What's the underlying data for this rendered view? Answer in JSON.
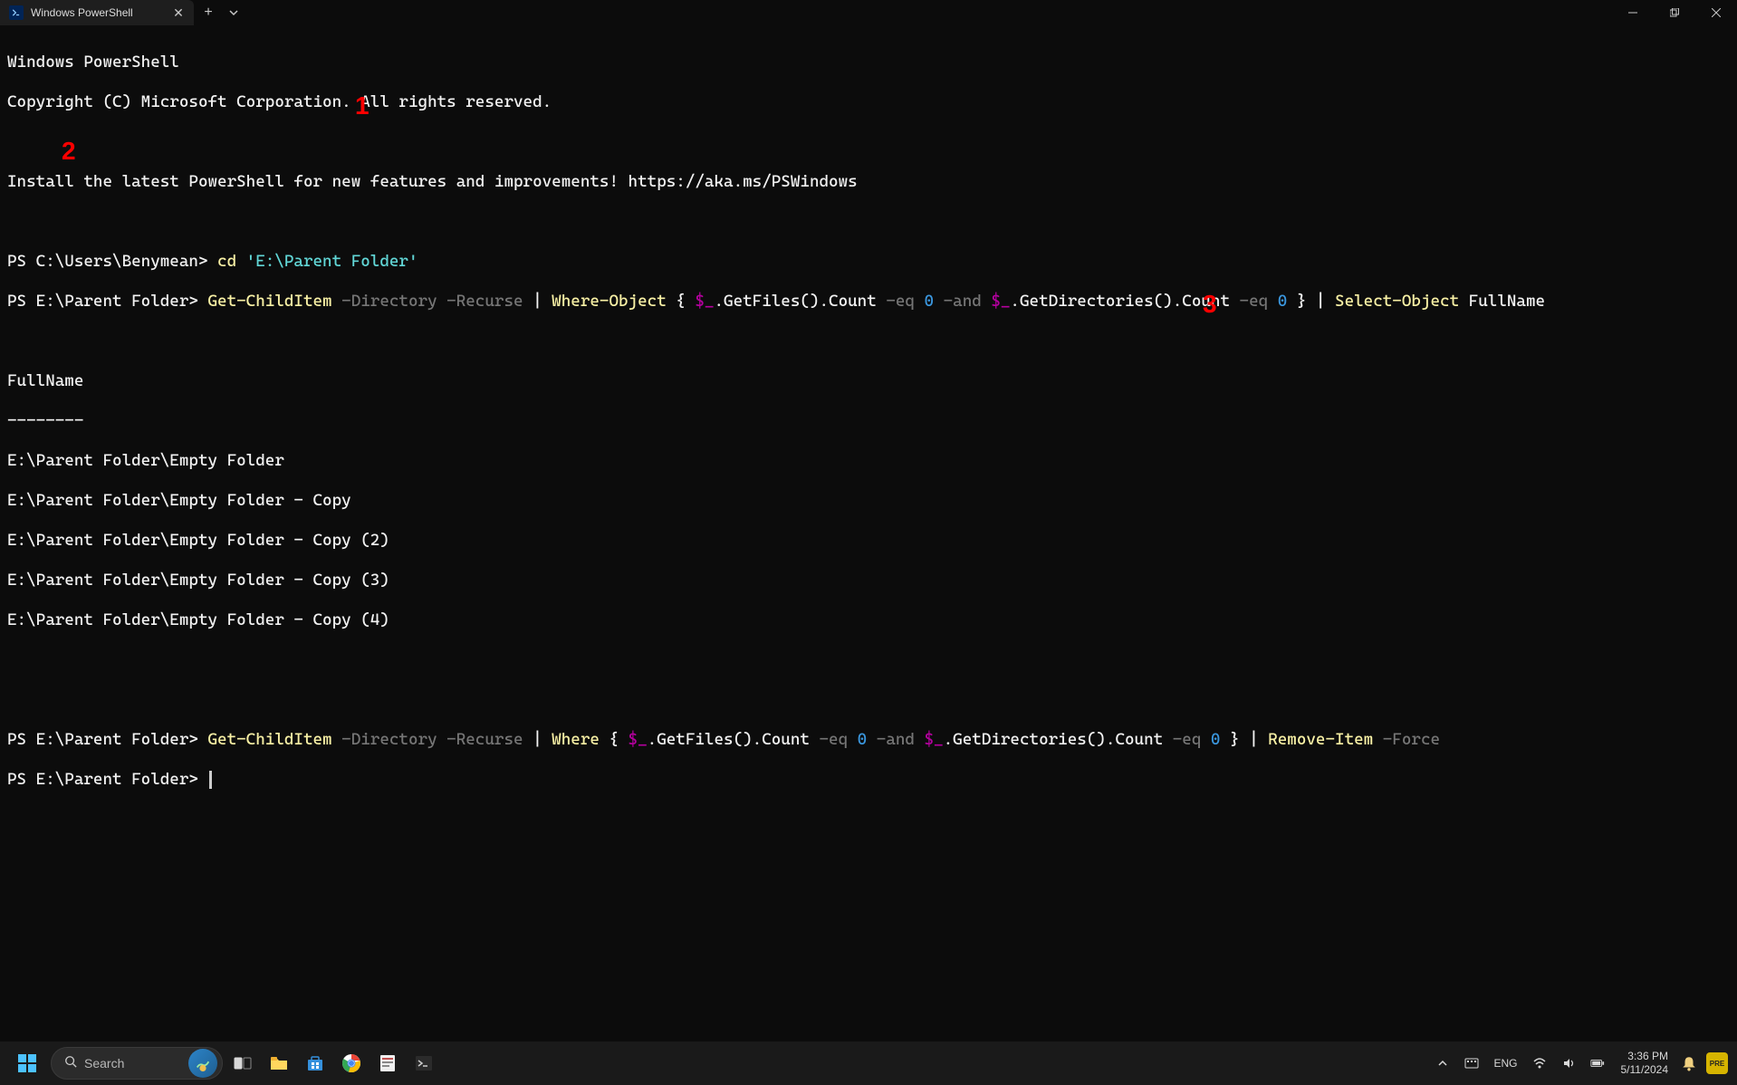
{
  "titlebar": {
    "tab_title": "Windows PowerShell"
  },
  "terminal": {
    "banner1": "Windows PowerShell",
    "banner2": "Copyright (C) Microsoft Corporation. All rights reserved.",
    "banner3": "Install the latest PowerShell for new features and improvements! https://aka.ms/PSWindows",
    "prompt1_prefix": "PS C:\\Users\\Benymean>",
    "cmd1": " cd ",
    "cmd1_arg": "'E:\\Parent Folder'",
    "prompt2_prefix": "PS E:\\Parent Folder>",
    "cmd2_a": " Get-ChildItem",
    "cmd2_b": " -Directory -Recurse",
    "cmd2_c": " |",
    "cmd2_d": " Where-Object",
    "cmd2_e": " { ",
    "cmd2_f": "$_",
    "cmd2_g": ".GetFiles().Count ",
    "cmd2_h": "-eq",
    "cmd2_i": " 0",
    "cmd2_j": " -and ",
    "cmd2_k": "$_",
    "cmd2_l": ".GetDirectories().Count ",
    "cmd2_m": "-eq",
    "cmd2_n": " 0",
    "cmd2_o": " } | ",
    "cmd2_p": "Select-Object",
    "cmd2_q": " FullName",
    "header": "FullName",
    "divider": "--------",
    "rows": [
      "E:\\Parent Folder\\Empty Folder",
      "E:\\Parent Folder\\Empty Folder - Copy",
      "E:\\Parent Folder\\Empty Folder - Copy (2)",
      "E:\\Parent Folder\\Empty Folder - Copy (3)",
      "E:\\Parent Folder\\Empty Folder - Copy (4)"
    ],
    "prompt3_prefix": "PS E:\\Parent Folder>",
    "cmd3_a": " Get-ChildItem",
    "cmd3_b": " -Directory -Recurse",
    "cmd3_c": " |",
    "cmd3_d": " Where",
    "cmd3_e": " { ",
    "cmd3_f": "$_",
    "cmd3_g": ".GetFiles().Count ",
    "cmd3_h": "-eq",
    "cmd3_i": " 0",
    "cmd3_j": " -and ",
    "cmd3_k": "$_",
    "cmd3_l": ".GetDirectories().Count ",
    "cmd3_m": "-eq",
    "cmd3_n": " 0",
    "cmd3_o": " } | ",
    "cmd3_p": "Remove-Item",
    "cmd3_q": " -Force",
    "prompt4_prefix": "PS E:\\Parent Folder> ",
    "annotations": {
      "a1": "1",
      "a2": "2",
      "a3": "3"
    }
  },
  "taskbar": {
    "search_placeholder": "Search",
    "lang": "ENG",
    "time": "3:36 PM",
    "date": "5/11/2024",
    "pre": "PRE"
  }
}
